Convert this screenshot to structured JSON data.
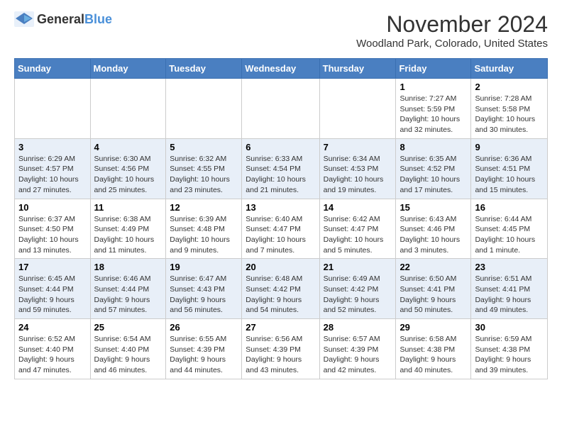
{
  "logo": {
    "text_general": "General",
    "text_blue": "Blue"
  },
  "title": "November 2024",
  "subtitle": "Woodland Park, Colorado, United States",
  "days_of_week": [
    "Sunday",
    "Monday",
    "Tuesday",
    "Wednesday",
    "Thursday",
    "Friday",
    "Saturday"
  ],
  "weeks": [
    [
      {
        "day": "",
        "info": ""
      },
      {
        "day": "",
        "info": ""
      },
      {
        "day": "",
        "info": ""
      },
      {
        "day": "",
        "info": ""
      },
      {
        "day": "",
        "info": ""
      },
      {
        "day": "1",
        "info": "Sunrise: 7:27 AM\nSunset: 5:59 PM\nDaylight: 10 hours and 32 minutes."
      },
      {
        "day": "2",
        "info": "Sunrise: 7:28 AM\nSunset: 5:58 PM\nDaylight: 10 hours and 30 minutes."
      }
    ],
    [
      {
        "day": "3",
        "info": "Sunrise: 6:29 AM\nSunset: 4:57 PM\nDaylight: 10 hours and 27 minutes."
      },
      {
        "day": "4",
        "info": "Sunrise: 6:30 AM\nSunset: 4:56 PM\nDaylight: 10 hours and 25 minutes."
      },
      {
        "day": "5",
        "info": "Sunrise: 6:32 AM\nSunset: 4:55 PM\nDaylight: 10 hours and 23 minutes."
      },
      {
        "day": "6",
        "info": "Sunrise: 6:33 AM\nSunset: 4:54 PM\nDaylight: 10 hours and 21 minutes."
      },
      {
        "day": "7",
        "info": "Sunrise: 6:34 AM\nSunset: 4:53 PM\nDaylight: 10 hours and 19 minutes."
      },
      {
        "day": "8",
        "info": "Sunrise: 6:35 AM\nSunset: 4:52 PM\nDaylight: 10 hours and 17 minutes."
      },
      {
        "day": "9",
        "info": "Sunrise: 6:36 AM\nSunset: 4:51 PM\nDaylight: 10 hours and 15 minutes."
      }
    ],
    [
      {
        "day": "10",
        "info": "Sunrise: 6:37 AM\nSunset: 4:50 PM\nDaylight: 10 hours and 13 minutes."
      },
      {
        "day": "11",
        "info": "Sunrise: 6:38 AM\nSunset: 4:49 PM\nDaylight: 10 hours and 11 minutes."
      },
      {
        "day": "12",
        "info": "Sunrise: 6:39 AM\nSunset: 4:48 PM\nDaylight: 10 hours and 9 minutes."
      },
      {
        "day": "13",
        "info": "Sunrise: 6:40 AM\nSunset: 4:47 PM\nDaylight: 10 hours and 7 minutes."
      },
      {
        "day": "14",
        "info": "Sunrise: 6:42 AM\nSunset: 4:47 PM\nDaylight: 10 hours and 5 minutes."
      },
      {
        "day": "15",
        "info": "Sunrise: 6:43 AM\nSunset: 4:46 PM\nDaylight: 10 hours and 3 minutes."
      },
      {
        "day": "16",
        "info": "Sunrise: 6:44 AM\nSunset: 4:45 PM\nDaylight: 10 hours and 1 minute."
      }
    ],
    [
      {
        "day": "17",
        "info": "Sunrise: 6:45 AM\nSunset: 4:44 PM\nDaylight: 9 hours and 59 minutes."
      },
      {
        "day": "18",
        "info": "Sunrise: 6:46 AM\nSunset: 4:44 PM\nDaylight: 9 hours and 57 minutes."
      },
      {
        "day": "19",
        "info": "Sunrise: 6:47 AM\nSunset: 4:43 PM\nDaylight: 9 hours and 56 minutes."
      },
      {
        "day": "20",
        "info": "Sunrise: 6:48 AM\nSunset: 4:42 PM\nDaylight: 9 hours and 54 minutes."
      },
      {
        "day": "21",
        "info": "Sunrise: 6:49 AM\nSunset: 4:42 PM\nDaylight: 9 hours and 52 minutes."
      },
      {
        "day": "22",
        "info": "Sunrise: 6:50 AM\nSunset: 4:41 PM\nDaylight: 9 hours and 50 minutes."
      },
      {
        "day": "23",
        "info": "Sunrise: 6:51 AM\nSunset: 4:41 PM\nDaylight: 9 hours and 49 minutes."
      }
    ],
    [
      {
        "day": "24",
        "info": "Sunrise: 6:52 AM\nSunset: 4:40 PM\nDaylight: 9 hours and 47 minutes."
      },
      {
        "day": "25",
        "info": "Sunrise: 6:54 AM\nSunset: 4:40 PM\nDaylight: 9 hours and 46 minutes."
      },
      {
        "day": "26",
        "info": "Sunrise: 6:55 AM\nSunset: 4:39 PM\nDaylight: 9 hours and 44 minutes."
      },
      {
        "day": "27",
        "info": "Sunrise: 6:56 AM\nSunset: 4:39 PM\nDaylight: 9 hours and 43 minutes."
      },
      {
        "day": "28",
        "info": "Sunrise: 6:57 AM\nSunset: 4:39 PM\nDaylight: 9 hours and 42 minutes."
      },
      {
        "day": "29",
        "info": "Sunrise: 6:58 AM\nSunset: 4:38 PM\nDaylight: 9 hours and 40 minutes."
      },
      {
        "day": "30",
        "info": "Sunrise: 6:59 AM\nSunset: 4:38 PM\nDaylight: 9 hours and 39 minutes."
      }
    ]
  ]
}
